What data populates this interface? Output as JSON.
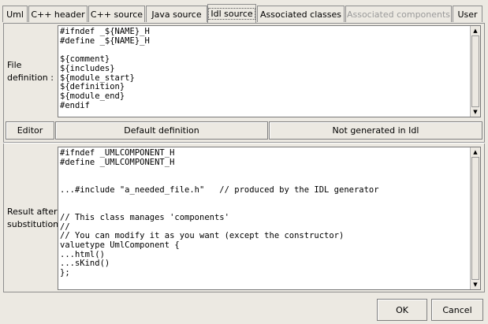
{
  "tabs": [
    {
      "label": "Uml",
      "state": "normal"
    },
    {
      "label": "C++ header",
      "state": "normal"
    },
    {
      "label": "C++ source",
      "state": "normal"
    },
    {
      "label": "Java source",
      "state": "normal"
    },
    {
      "label": "Idl source",
      "state": "active"
    },
    {
      "label": "Associated classes",
      "state": "normal"
    },
    {
      "label": "Associated components",
      "state": "disabled"
    },
    {
      "label": "User",
      "state": "normal"
    }
  ],
  "file_definition": {
    "label_line1": "File",
    "label_line2": "definition :",
    "code": "#ifndef _${NAME}_H\n#define _${NAME}_H\n\n${comment}\n${includes}\n${module_start}\n${definition}\n${module_end}\n#endif"
  },
  "buttons": {
    "editor": "Editor",
    "default_definition": "Default definition",
    "not_generated": "Not generated in Idl",
    "ok": "OK",
    "cancel": "Cancel"
  },
  "result": {
    "label_line1": "Result after",
    "label_line2": "substitution :",
    "code": "#ifndef _UMLCOMPONENT_H\n#define _UMLCOMPONENT_H\n\n\n...#include \"a_needed_file.h\"   // produced by the IDL generator\n\n\n// This class manages 'components'\n//\n// You can modify it as you want (except the constructor)\nvaluetype UmlComponent {\n...html()\n...sKind()\n};"
  }
}
